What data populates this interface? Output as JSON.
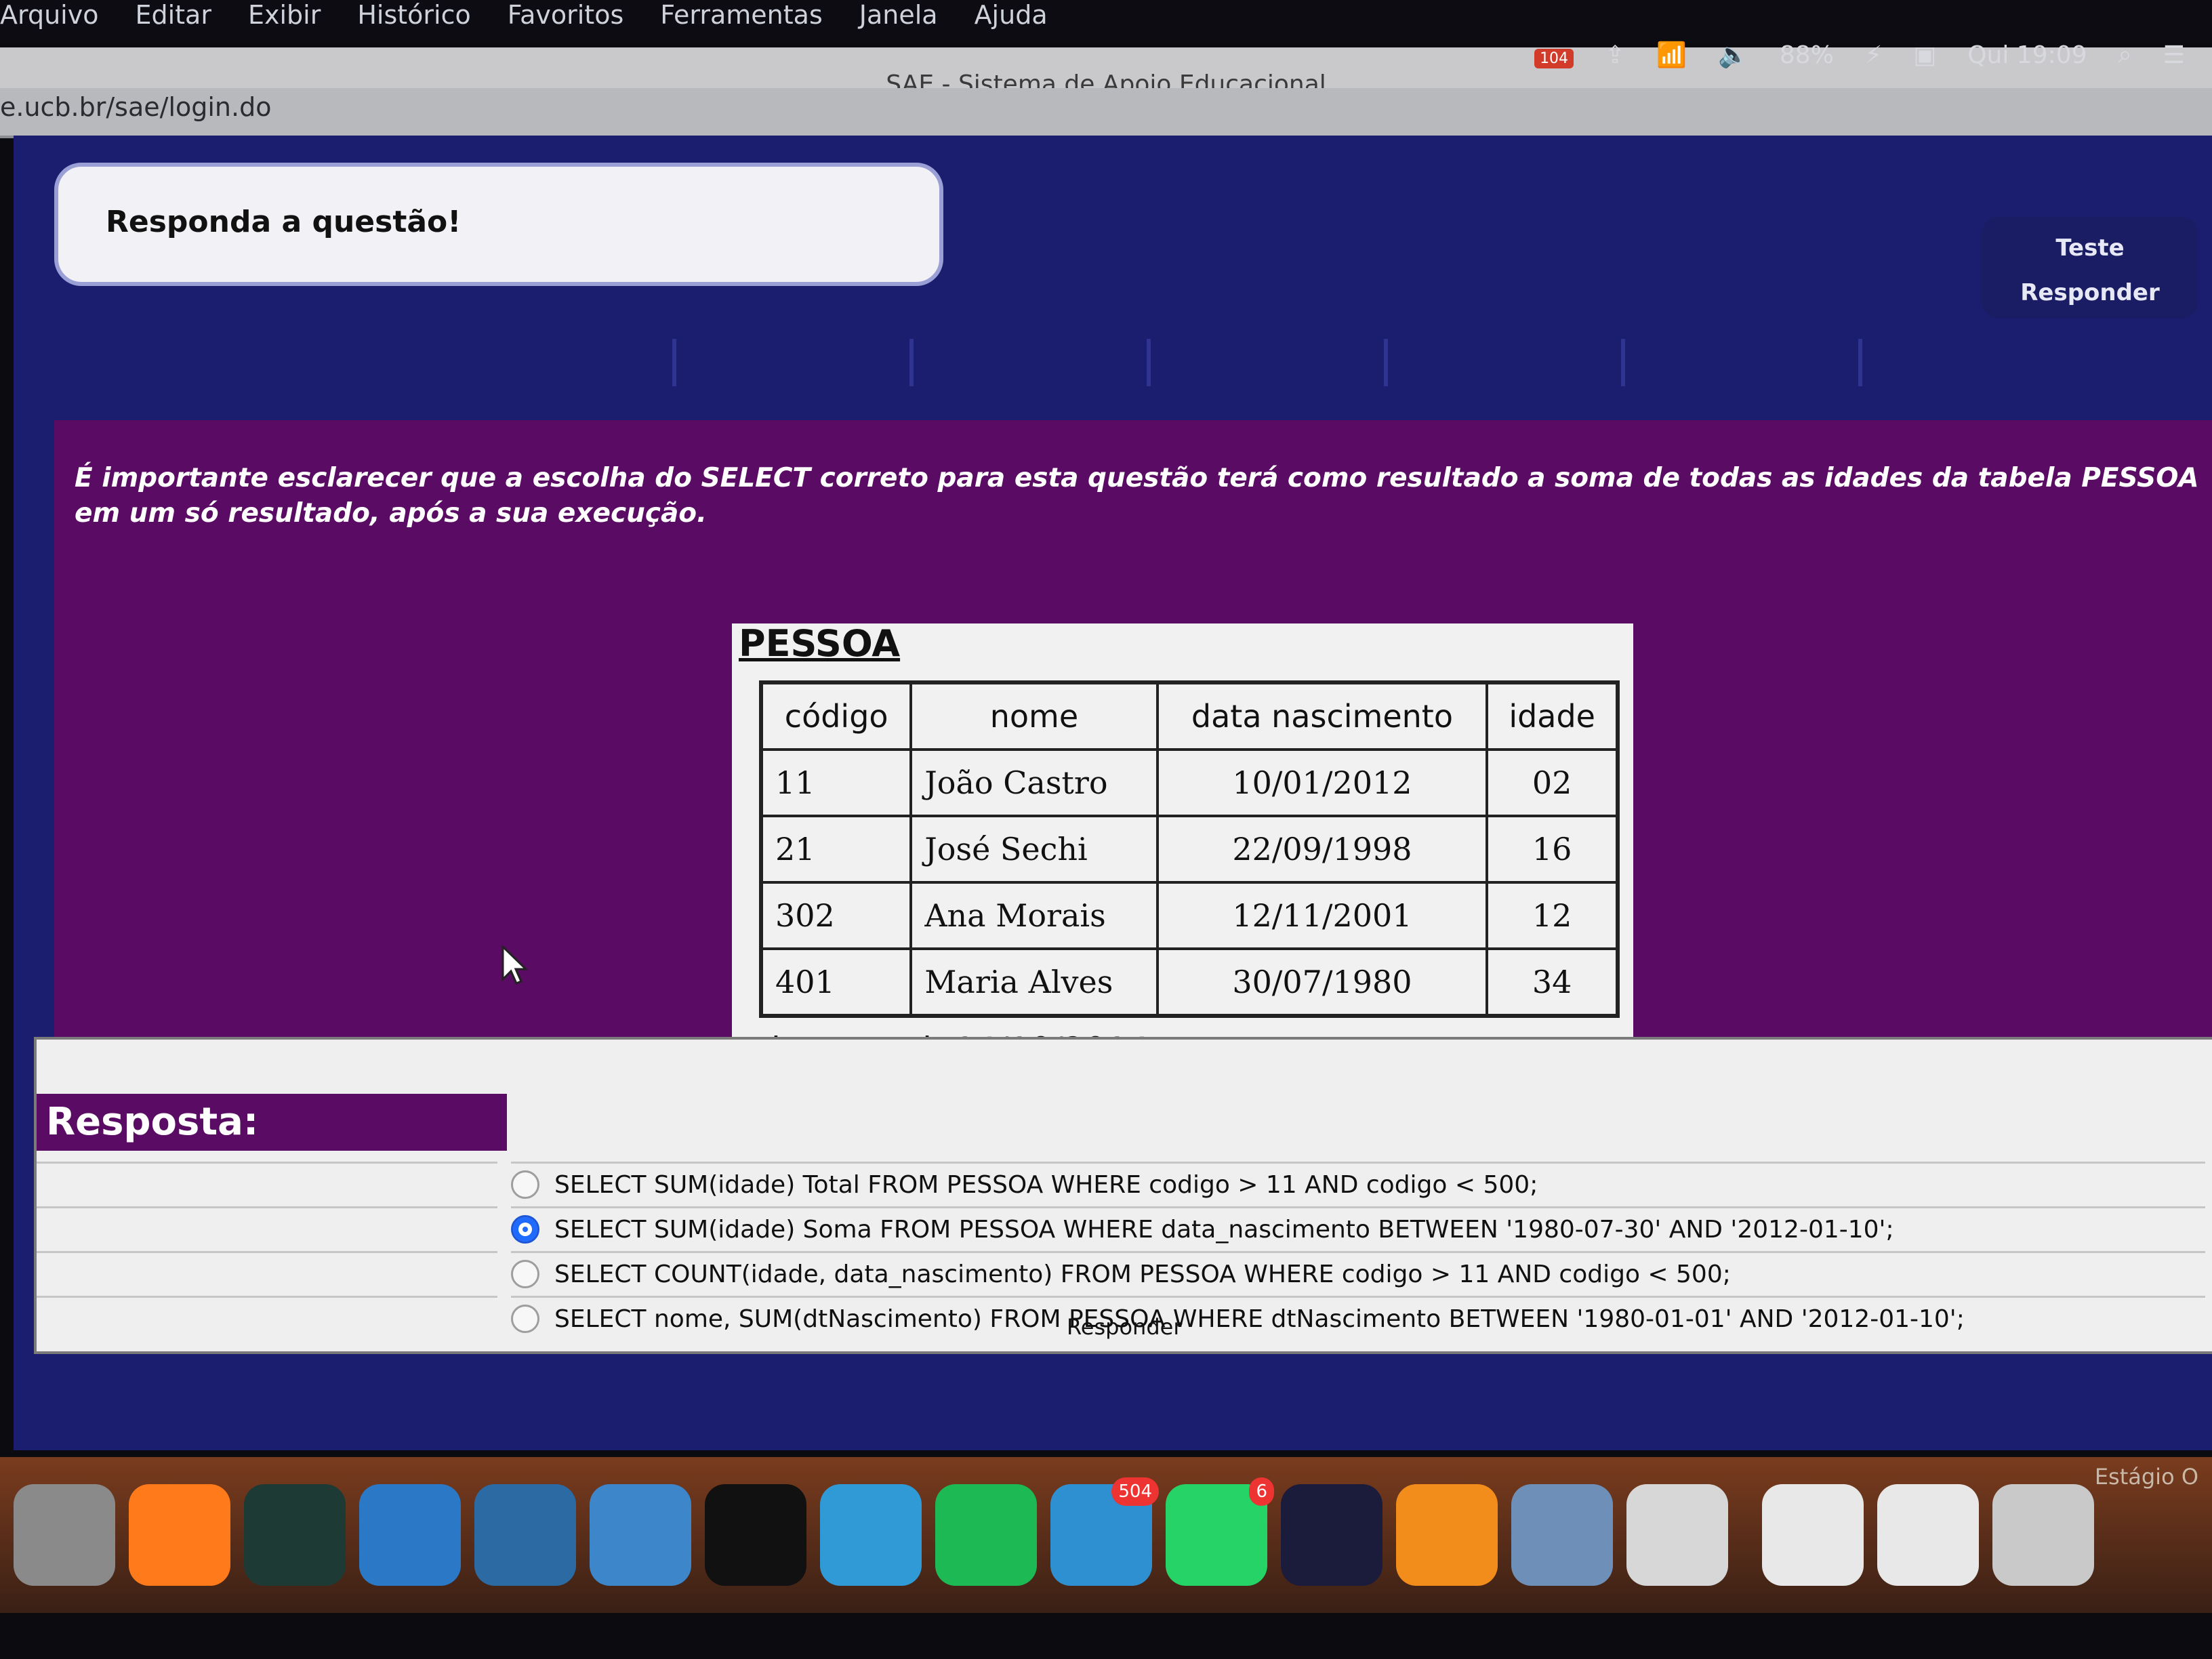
{
  "os": {
    "menu": [
      "Arquivo",
      "Editar",
      "Exibir",
      "Histórico",
      "Favoritos",
      "Ferramentas",
      "Janela",
      "Ajuda"
    ],
    "status": {
      "battery": "88%",
      "time": "Qui 19:09",
      "badge": "104"
    }
  },
  "browser": {
    "title": "SAE - Sistema de Apoio Educacional",
    "url": "e.ucb.br/sae/login.do"
  },
  "page": {
    "header_text": "Responda a questão!",
    "buttons": [
      "Teste",
      "Responder"
    ],
    "nav_tabs": [
      "",
      "",
      "",
      "",
      "",
      ""
    ],
    "notice": "É importante esclarecer que a escolha do SELECT correto para esta questão terá como resultado a soma de todas as idades da tabela PESSOA em um só resultado, após a sua execução.",
    "table": {
      "name": "PESSOA",
      "headers": [
        "código",
        "nome",
        "data nascimento",
        "idade"
      ],
      "rows": [
        [
          "11",
          "João Castro",
          "10/01/2012",
          "02"
        ],
        [
          "21",
          "José Sechi",
          "22/09/1998",
          "16"
        ],
        [
          "302",
          "Ana Morais",
          "12/11/2001",
          "12"
        ],
        [
          "401",
          "Maria Alves",
          "30/07/1980",
          "34"
        ]
      ]
    },
    "current_date": "data atual: 14/10/2014",
    "answer_label": "Resposta:",
    "options": [
      "SELECT SUM(idade) Total FROM PESSOA WHERE codigo > 11 AND codigo < 500;",
      "SELECT SUM(idade) Soma FROM PESSOA WHERE data_nascimento BETWEEN '1980-07-30' AND '2012-01-10';",
      "SELECT COUNT(idade, data_nascimento) FROM PESSOA WHERE codigo > 11 AND codigo < 500;",
      "SELECT nome, SUM(dtNascimento) FROM PESSOA WHERE dtNascimento BETWEEN '1980-01-01' AND '2012-01-10';"
    ],
    "selected_index": 1,
    "submit_label": "Responder"
  },
  "dock": {
    "badges": {
      "telegram": "504",
      "whatsapp": "6"
    },
    "label": "Estágio O"
  }
}
